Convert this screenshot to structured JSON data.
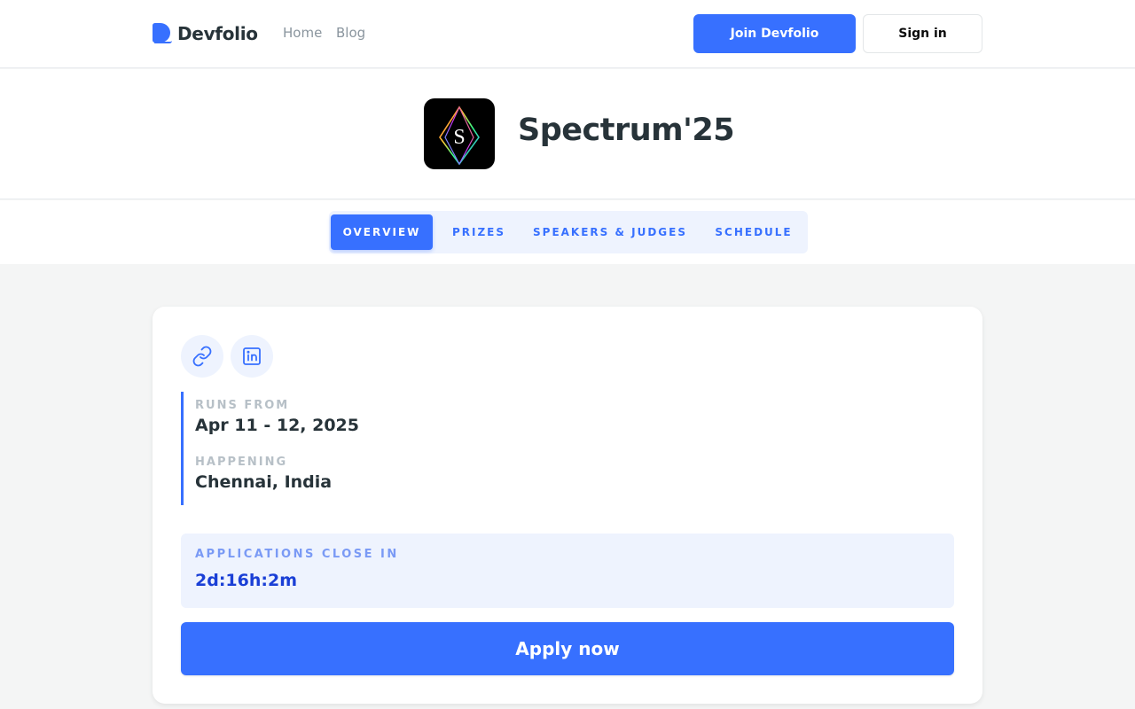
{
  "nav": {
    "brand": "Devfolio",
    "links": [
      {
        "label": "Home"
      },
      {
        "label": "Blog"
      }
    ],
    "join_label": "Join Devfolio",
    "signin_label": "Sign in"
  },
  "event": {
    "logo_letter": "S",
    "title": "Spectrum'25"
  },
  "tabs": [
    {
      "label": "OVERVIEW",
      "active": true
    },
    {
      "label": "PRIZES",
      "active": false
    },
    {
      "label": "SPEAKERS & JUDGES",
      "active": false
    },
    {
      "label": "SCHEDULE",
      "active": false
    }
  ],
  "card": {
    "icons": [
      "link-icon",
      "linkedin-icon"
    ],
    "runs_from_label": "RUNS FROM",
    "runs_from_value": "Apr 11 - 12, 2025",
    "happening_label": "HAPPENING",
    "happening_value": "Chennai, India",
    "deadline_label": "APPLICATIONS CLOSE IN",
    "deadline_value": "2d:16h:2m",
    "apply_label": "Apply now"
  },
  "colors": {
    "accent": "#3770ff",
    "accent_light": "#eef3fe",
    "text": "#273339",
    "muted": "#b7c0c7"
  }
}
